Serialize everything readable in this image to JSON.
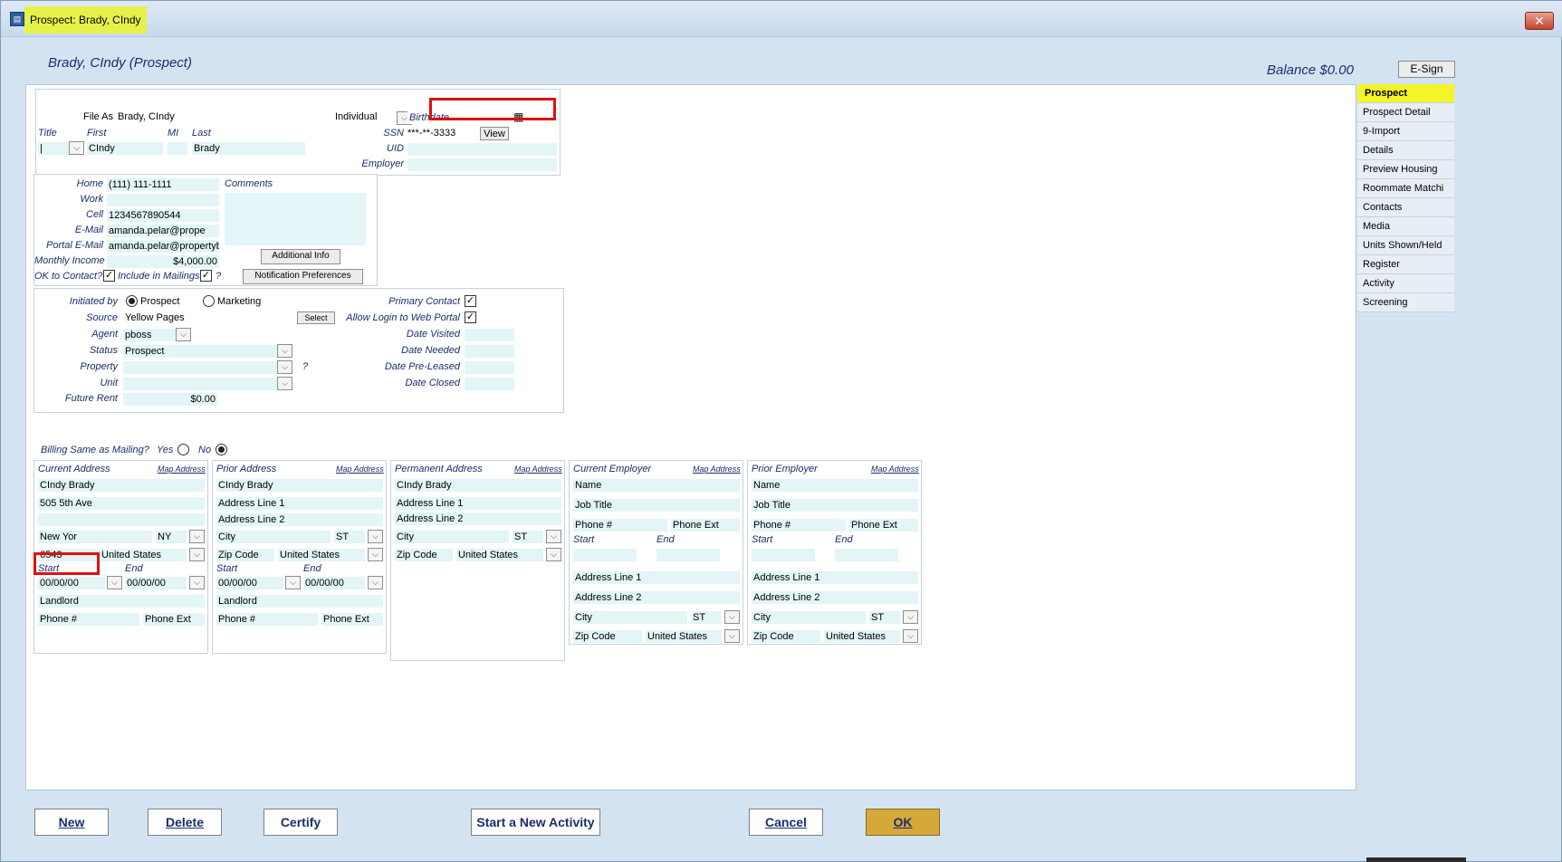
{
  "window": {
    "title": "Prospect: Brady, CIndy",
    "close": "✕"
  },
  "header": {
    "name": "Brady, CIndy (Prospect)",
    "balance": "Balance $0.00",
    "esign": "E-Sign"
  },
  "person": {
    "file_as_label": "File As",
    "file_as": "Brady, CIndy",
    "type": "Individual",
    "title_label": "Title",
    "first_label": "First",
    "mi_label": "MI",
    "last_label": "Last",
    "first": "CIndy",
    "last": "Brady",
    "birthdate_placeholder": "Birthdate",
    "ssn_label": "SSN",
    "ssn": "***-**-3333",
    "view_label": "View",
    "uid_label": "UID",
    "employer_label": "Employer"
  },
  "contact": {
    "home_label": "Home",
    "home": "(111) 111-1111",
    "work_label": "Work",
    "cell_label": "Cell",
    "cell": "1234567890544",
    "email_label": "E-Mail",
    "email": "amanda.pelar@prope",
    "portal_email_label": "Portal E-Mail",
    "portal_email": "amanda.pelar@propertybo",
    "monthly_income_label": "Monthly Income",
    "monthly_income": "$4,000.00",
    "ok_contact_label": "OK to Contact?",
    "include_mailings_label": "Include in Mailings?",
    "q": "?",
    "comments_label": "Comments",
    "additional_info": "Additional Info",
    "notification_prefs": "Notification Preferences"
  },
  "lead": {
    "initiated_label": "Initiated by",
    "prospect_opt": "Prospect",
    "marketing_opt": "Marketing",
    "source_label": "Source",
    "source": "Yellow Pages",
    "select_label": "Select",
    "agent_label": "Agent",
    "agent": "pboss",
    "status_label": "Status",
    "status": "Prospect",
    "property_label": "Property",
    "q": "?",
    "unit_label": "Unit",
    "future_rent_label": "Future Rent",
    "future_rent": "$0.00",
    "primary_contact_label": "Primary Contact",
    "allow_login_label": "Allow Login to Web Portal",
    "date_visited_label": "Date Visited",
    "date_needed_label": "Date Needed",
    "date_preleased_label": "Date Pre-Leased",
    "date_closed_label": "Date Closed"
  },
  "billing": {
    "label": "Billing Same as Mailing?",
    "yes": "Yes",
    "no": "No"
  },
  "current_address": {
    "title": "Current Address",
    "map": "Map Address",
    "name": "CIndy  Brady",
    "line1": "505 5th Ave",
    "city": "New Yor",
    "state": "NY",
    "zip": "6543",
    "country": "United States",
    "start_label": "Start",
    "end_label": "End",
    "start": "00/00/00",
    "end": "00/00/00",
    "landlord": "Landlord",
    "phone": "Phone #",
    "phone_ext": "Phone Ext"
  },
  "prior_address": {
    "title": "Prior Address",
    "map": "Map Address",
    "name": "CIndy  Brady",
    "line1": "Address Line 1",
    "line2": "Address Line 2",
    "city": "City",
    "state": "ST",
    "zip": "Zip Code",
    "country": "United States",
    "start_label": "Start",
    "end_label": "End",
    "start": "00/00/00",
    "end": "00/00/00",
    "landlord": "Landlord",
    "phone": "Phone #",
    "phone_ext": "Phone Ext"
  },
  "permanent_address": {
    "title": "Permanent Address",
    "map": "Map Address",
    "name": "CIndy  Brady",
    "line1": "Address Line 1",
    "line2": "Address Line 2",
    "city": "City",
    "state": "ST",
    "zip": "Zip Code",
    "country": "United States"
  },
  "current_employer": {
    "title": "Current Employer",
    "map": "Map Address",
    "name": "Name",
    "job": "Job Title",
    "phone": "Phone #",
    "phone_ext": "Phone Ext",
    "start_label": "Start",
    "end_label": "End",
    "line1": "Address Line 1",
    "line2": "Address Line 2",
    "city": "City",
    "state": "ST",
    "zip": "Zip Code",
    "country": "United States"
  },
  "prior_employer": {
    "title": "Prior Employer",
    "map": "Map Address",
    "name": "Name",
    "job": "Job Title",
    "phone": "Phone #",
    "phone_ext": "Phone Ext",
    "start_label": "Start",
    "end_label": "End",
    "line1": "Address Line 1",
    "line2": "Address Line 2",
    "city": "City",
    "state": "ST",
    "zip": "Zip Code",
    "country": "United States"
  },
  "nav": {
    "items": [
      "Prospect",
      "Prospect Detail",
      "9-Import",
      "Details",
      "Preview Housing",
      "Roommate Matchi",
      "Contacts",
      "Media",
      "Units Shown/Held",
      "Register",
      "Activity",
      "Screening"
    ]
  },
  "buttons": {
    "new": "New",
    "delete": "Delete",
    "certify": "Certify",
    "new_activity": "Start a New Activity",
    "cancel": "Cancel",
    "ok": "OK"
  },
  "colors": {
    "label_blue": "#1a2d6b",
    "field_bg": "#e3f5f6",
    "highlight": "#f4f428",
    "ok_btn": "#d4a93a",
    "red_box": "#e01010"
  }
}
